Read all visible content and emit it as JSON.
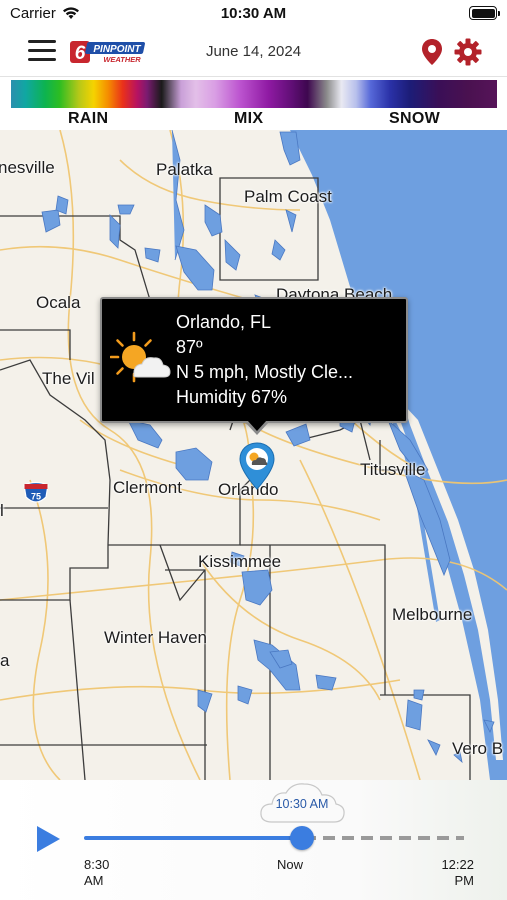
{
  "status_bar": {
    "carrier": "Carrier",
    "time": "10:30 AM"
  },
  "header": {
    "date": "June 14, 2024",
    "logo_number": "6",
    "logo_brand": "PINPOINT",
    "logo_sub": "WEATHER"
  },
  "legend": {
    "rain": "RAIN",
    "mix": "MIX",
    "snow": "SNOW"
  },
  "map": {
    "cities": [
      "nesville",
      "Palatka",
      "Palm Coast",
      "Daytona Beach",
      "Ocala",
      "The Vil",
      "Titusville",
      "Clermont",
      "Orlando",
      "Kissimmee",
      "Melbourne",
      "Winter Haven",
      "Vero B",
      "l",
      "a"
    ],
    "interstate": "75"
  },
  "popup": {
    "city": "Orlando, FL",
    "temperature": "87º",
    "wind_conditions": "N 5 mph,  Mostly Cle...",
    "humidity": "Humidity 67%",
    "icon": "partly-sunny-icon"
  },
  "timeline": {
    "current_time": "10:30 AM",
    "start_time": "8:30",
    "start_period": "AM",
    "now_label": "Now",
    "end_time": "12:22",
    "end_period": "PM",
    "progress_percent": 60
  },
  "colors": {
    "accent": "#3b7de0",
    "brand_red": "#c8262e",
    "water": "#6e9fe0",
    "map_land": "#f4f1ea"
  }
}
